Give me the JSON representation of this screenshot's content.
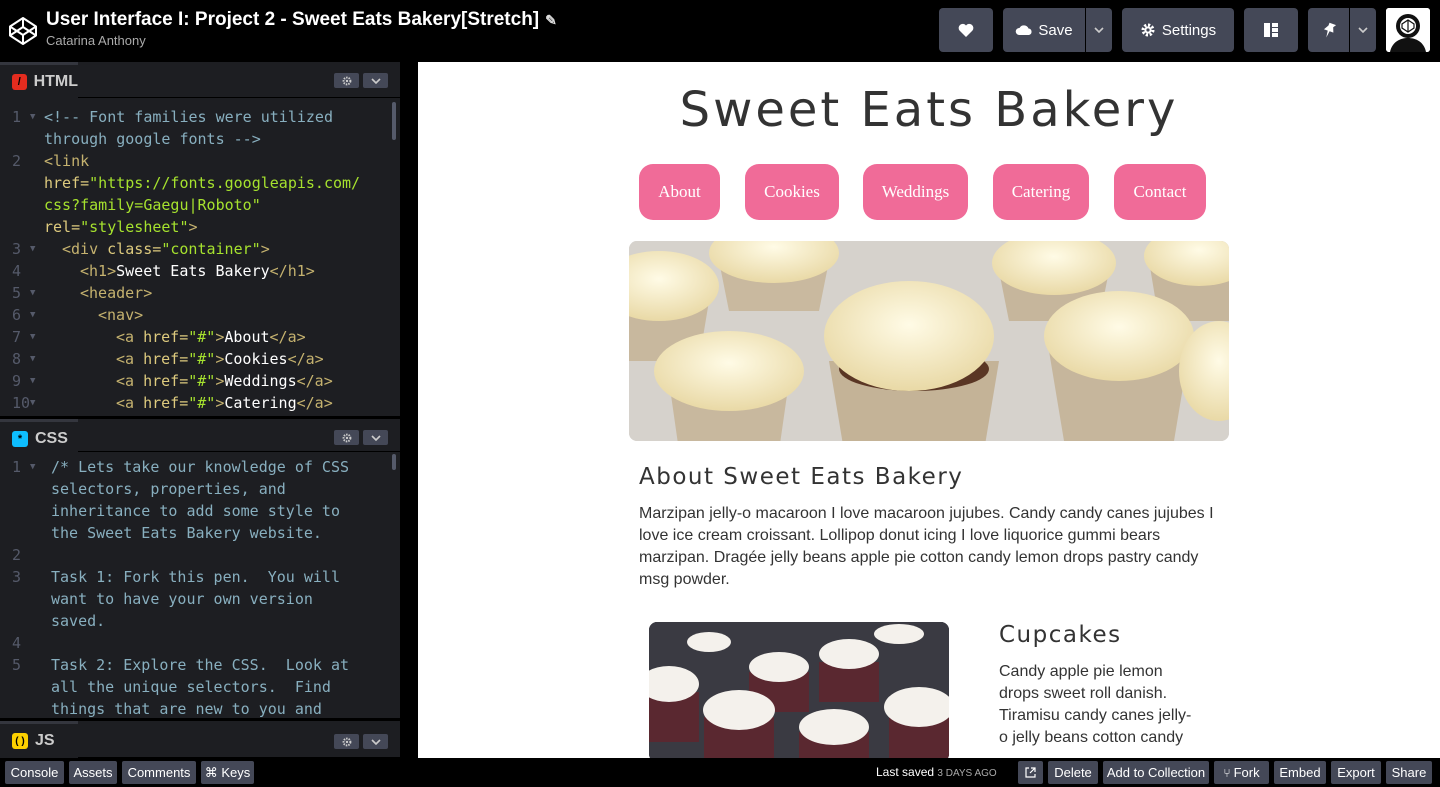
{
  "header": {
    "title": "User Interface I: Project 2 - Sweet Eats Bakery[Stretch]",
    "author": "Catarina Anthony",
    "save_label": "Save",
    "settings_label": "Settings"
  },
  "editors": {
    "html": {
      "label": "HTML",
      "line_numbers": [
        "1",
        "2",
        "3",
        "4",
        "5",
        "6",
        "7",
        "8",
        "9",
        "10"
      ]
    },
    "css": {
      "label": "CSS",
      "line_numbers": [
        "1",
        "2",
        "3",
        "4",
        "5"
      ],
      "lines": [
        "/* Lets take our knowledge of CSS",
        "selectors, properties, and",
        "inheritance to add some style to",
        "the Sweet Eats Bakery website.",
        "Task 1: Fork this pen.  You will",
        "want to have your own version",
        "saved.",
        "Task 2: Explore the CSS.  Look at",
        "all the unique selectors.  Find",
        "things that are new to you and"
      ]
    },
    "js": {
      "label": "JS"
    }
  },
  "preview": {
    "site_title": "Sweet Eats Bakery",
    "nav": [
      "About",
      "Cookies",
      "Weddings",
      "Catering",
      "Contact"
    ],
    "about_heading": "About Sweet Eats Bakery",
    "about_lines": [
      "Marzipan jelly-o macaroon I love macaroon jujubes. Candy candy canes jujubes I",
      "love ice cream croissant. Lollipop donut icing I love liquorice gummi bears",
      "marzipan. Dragée jelly beans apple pie cotton candy lemon drops pastry candy",
      "msg powder."
    ],
    "cupcakes_heading": "Cupcakes",
    "cupcakes_lines": [
      "Candy apple pie lemon",
      "drops sweet roll danish.",
      "Tiramisu candy canes jelly-",
      "o jelly beans cotton candy"
    ]
  },
  "footer": {
    "console": "Console",
    "assets": "Assets",
    "comments": "Comments",
    "keys": "⌘ Keys",
    "last_saved": "Last saved",
    "last_saved_when": "3 DAYS AGO",
    "delete": "Delete",
    "add_to_collection": "Add to Collection",
    "fork": "Fork",
    "embed": "Embed",
    "export": "Export",
    "share": "Share"
  }
}
